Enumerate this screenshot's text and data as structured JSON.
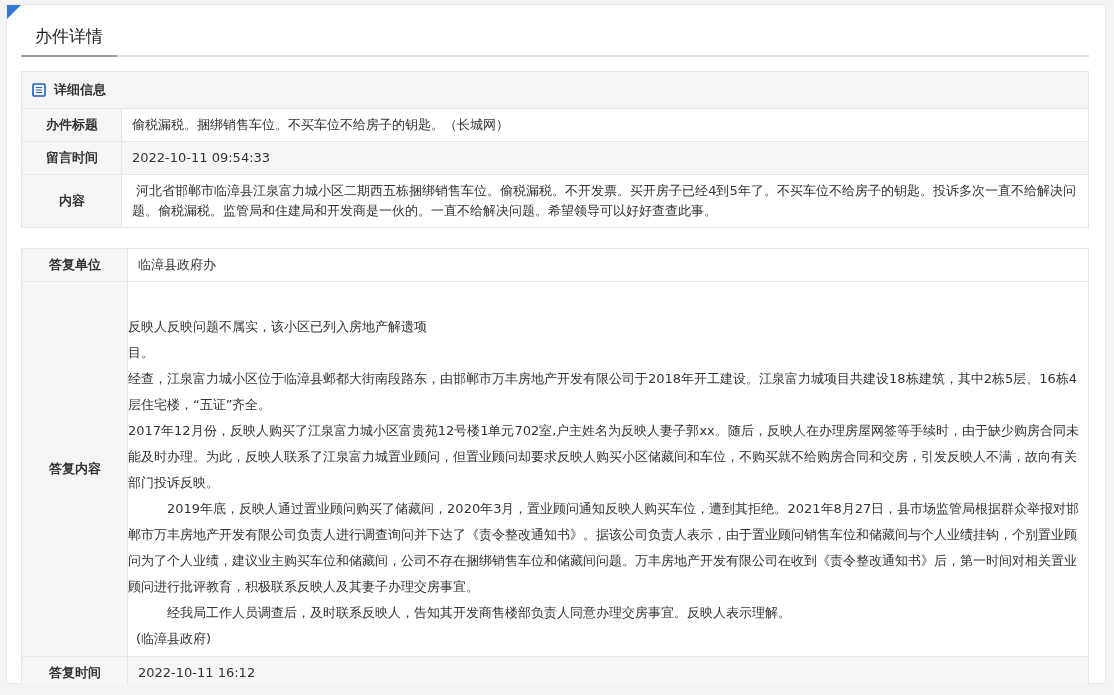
{
  "page_title": "办件详情",
  "detail": {
    "heading": "详细信息",
    "rows": [
      {
        "label": "办件标题",
        "value": "偷税漏税。捆绑销售车位。不买车位不给房子的钥匙。（长城网）"
      },
      {
        "label": "留言时间",
        "value": "2022-10-11 09:54:33"
      },
      {
        "label": "内容",
        "value": " 河北省邯郸市临漳县江泉富力城小区二期西五栋捆绑销售车位。偷税漏税。不开发票。买开房子已经4到5年了。不买车位不给房子的钥匙。投诉多次一直不给解决问题。偷税漏税。监管局和住建局和开发商是一伙的。一直不给解决问题。希望领导可以好好查查此事。"
      }
    ]
  },
  "reply": {
    "unit": {
      "label": "答复单位",
      "value": "临漳县政府办"
    },
    "content": {
      "label": "答复内容",
      "paragraphs": [
        {
          "kind": "plain",
          "text": "反映人反映问题不属实，该小区已列入房地产解遗项"
        },
        {
          "kind": "plain",
          "text": "目。"
        },
        {
          "kind": "plain",
          "text": "经查，江泉富力城小区位于临漳县邺都大街南段路东，由邯郸市万丰房地产开发有限公司于2018年开工建设。江泉富力城项目共建设18栋建筑，其中2栋5层、16栋4层住宅楼，“五证”齐全。"
        },
        {
          "kind": "plain",
          "text": "2017年12月份，反映人购买了江泉富力城小区富贵苑12号楼1单元702室,户主姓名为反映人妻子郭xx。随后，反映人在办理房屋网签等手续时，由于缺少购房合同未能及时办理。为此，反映人联系了江泉富力城置业顾问，但置业顾问却要求反映人购买小区储藏间和车位，不购买就不给购房合同和交房，引发反映人不满，故向有关部门投诉反映。"
        },
        {
          "kind": "indented",
          "text": "2019年底，反映人通过置业顾问购买了储藏间，2020年3月，置业顾问通知反映人购买车位，遭到其拒绝。2021年8月27日，县市场监管局根据群众举报对邯郸市万丰房地产开发有限公司负责人进行调查询问并下达了《责令整改通知书》。据该公司负责人表示，由于置业顾问销售车位和储藏间与个人业绩挂钩，个别置业顾问为了个人业绩，建议业主购买车位和储藏间，公司不存在捆绑销售车位和储藏间问题。万丰房地产开发有限公司在收到《责令整改通知书》后，第一时间对相关置业顾问进行批评教育，积极联系反映人及其妻子办理交房事宜。"
        },
        {
          "kind": "indented",
          "text": "经我局工作人员调查后，及时联系反映人，告知其开发商售楼部负责人同意办理交房事宜。反映人表示理解。"
        },
        {
          "kind": "signature",
          "text": "(临漳县政府)"
        }
      ]
    },
    "time": {
      "label": "答复时间",
      "value": "2022-10-11 16:12"
    }
  }
}
